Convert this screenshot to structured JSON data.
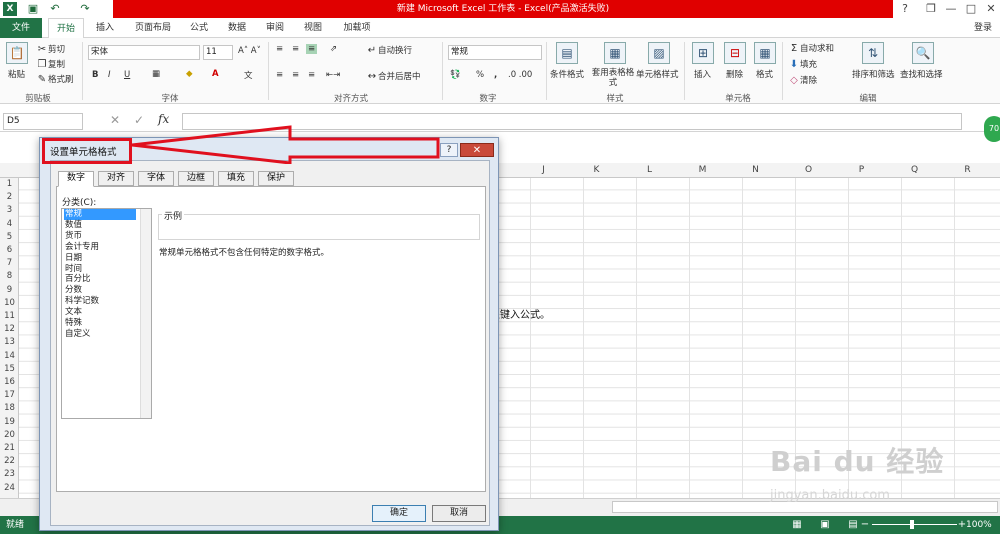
{
  "window": {
    "title": "新建 Microsoft Excel 工作表 - Excel(产品激活失败)",
    "login": "登录",
    "min_label": "—",
    "restore_label": "□",
    "close_label": "✕",
    "help_label": "?"
  },
  "ribbon_tabs": [
    "文件",
    "开始",
    "插入",
    "页面布局",
    "公式",
    "数据",
    "审阅",
    "视图",
    "加载项"
  ],
  "ribbon": {
    "clipboard": {
      "paste": "粘贴",
      "cut": "剪切",
      "copy": "复制",
      "painter": "格式刷",
      "label": "剪贴板"
    },
    "font": {
      "name": "宋体",
      "size": "11",
      "bold": "B",
      "italic": "I",
      "underline": "U",
      "label": "字体"
    },
    "align": {
      "wrap": "自动换行",
      "merge": "合并后居中",
      "label": "对齐方式"
    },
    "number": {
      "format": "常规",
      "percent": "%",
      "comma": ",",
      "label": "数字"
    },
    "styles": {
      "cond": "条件格式",
      "table": "套用表格格式",
      "cell": "单元格样式",
      "label": "样式"
    },
    "cells": {
      "insert": "插入",
      "delete": "删除",
      "format": "格式",
      "label": "单元格"
    },
    "editing": {
      "autosum": "自动求和",
      "fill": "填充",
      "clear": "清除",
      "sort": "排序和筛选",
      "find": "查找和选择",
      "label": "编辑"
    }
  },
  "formula_bar": {
    "name_box": "D5",
    "fx": "fx"
  },
  "columns": [
    "J",
    "K",
    "L",
    "M",
    "N",
    "O",
    "P",
    "Q",
    "R"
  ],
  "rows": [
    "1",
    "2",
    "3",
    "4",
    "5",
    "6",
    "7",
    "8",
    "9",
    "10",
    "11",
    "12",
    "13",
    "14",
    "15",
    "16",
    "17",
    "18",
    "19",
    "20",
    "21",
    "22",
    "23",
    "24"
  ],
  "cell_text": "处键入公式。",
  "dialog": {
    "title": "设置单元格格式",
    "help": "?",
    "close": "✕",
    "tabs": [
      "数字",
      "对齐",
      "字体",
      "边框",
      "填充",
      "保护"
    ],
    "category_label": "分类(C):",
    "categories": [
      "常规",
      "数值",
      "货币",
      "会计专用",
      "日期",
      "时间",
      "百分比",
      "分数",
      "科学记数",
      "文本",
      "特殊",
      "自定义"
    ],
    "sample_label": "示例",
    "description": "常规单元格格式不包含任何特定的数字格式。",
    "ok": "确定",
    "cancel": "取消"
  },
  "status": {
    "ready": "就绪",
    "zoom": "100%"
  },
  "watermark": {
    "line1": "Bai du 经验",
    "line2": "jingyan.baidu.com"
  },
  "badge": "70",
  "colors": {
    "excel_green": "#217346",
    "title_red": "#e00000",
    "annotation_red": "#e0101e",
    "selection_blue": "#3399ff"
  }
}
